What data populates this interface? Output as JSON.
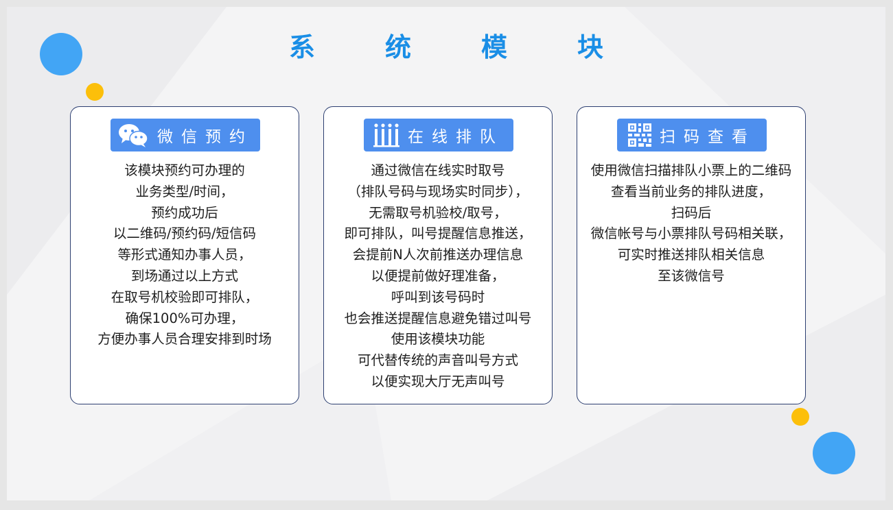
{
  "page_title": "系统模块",
  "title_chars": [
    "系",
    "统",
    "模",
    "块"
  ],
  "colors": {
    "title": "#1a8ee6",
    "badge": "#4e8fee",
    "blue_dot": "#42a5f5",
    "yellow_dot": "#fcbf0a",
    "card_border": "#2c3e70"
  },
  "cards": [
    {
      "icon": "wechat-icon",
      "label": "微信预约",
      "lines": [
        "该模块预约可办理的",
        "业务类型/时间，",
        "预约成功后",
        "以二维码/预约码/短信码",
        "等形式通知办事人员，",
        "到场通过以上方式",
        "在取号机校验即可排队，",
        "确保100%可办理，",
        "方便办事人员合理安排到时场"
      ]
    },
    {
      "icon": "queue-icon",
      "label": "在线排队",
      "lines": [
        "通过微信在线实时取号",
        "（排队号码与现场实时同步），",
        "无需取号机验校/取号，",
        "即可排队，叫号提醒信息推送，",
        "会提前N人次前推送办理信息",
        "以便提前做好理准备，",
        "呼叫到该号码时",
        "也会推送提醒信息避免错过叫号",
        "使用该模块功能",
        "可代替传统的声音叫号方式",
        "以便实现大厅无声叫号"
      ]
    },
    {
      "icon": "qr-code-icon",
      "label": "扫码查看",
      "lines": [
        "使用微信扫描排队小票上的二维码",
        "查看当前业务的排队进度，",
        "扫码后",
        "微信帐号与小票排队号码相关联，",
        "可实时推送排队相关信息",
        "至该微信号"
      ]
    }
  ]
}
